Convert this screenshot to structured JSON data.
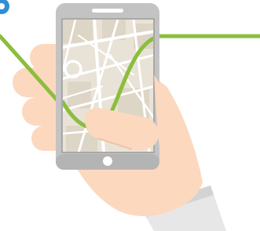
{
  "illustration": {
    "subject": "hand-holding-smartphone-with-map",
    "icons": [
      "route-line-icon",
      "smartphone-icon",
      "map-icon",
      "hand-icon",
      "sleeve-icon",
      "home-button-icon",
      "speaker-slot-icon"
    ]
  },
  "colors": {
    "background": "#ffffff",
    "route": "#8cbd3f",
    "route_marker": "#2f8ed4",
    "phone_body": "#c3c3c3",
    "phone_edge": "#b4b4b4",
    "screen_outline": "#9b9b9b",
    "map_background": "#e9e3d7",
    "map_block": "#ddd5c6",
    "map_street": "#ffffff",
    "skin": "#fcd8bf",
    "skin_shadow": "#efc3a6",
    "sleeve": "#e7e7e7",
    "sleeve_shadow": "#d3d3d3",
    "home_button": "#ffffff",
    "speaker_slot": "#ffffff"
  }
}
